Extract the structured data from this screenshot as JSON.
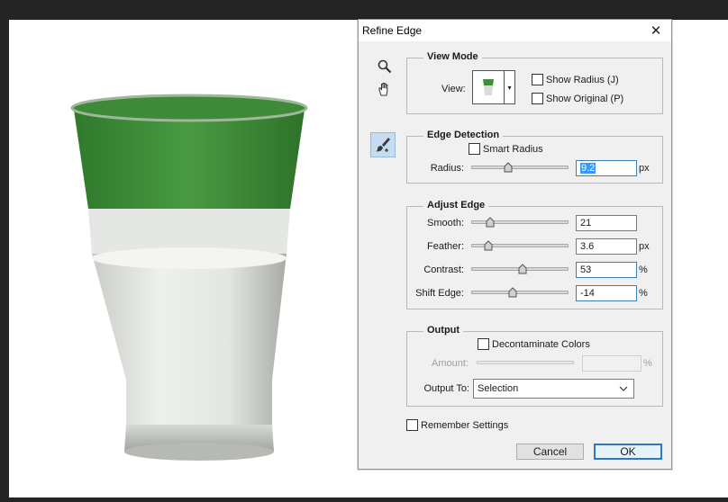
{
  "dialog": {
    "title": "Refine Edge",
    "close_glyph": "✕"
  },
  "tools": {
    "zoom_icon": "magnifier-icon",
    "hand_icon": "hand-icon",
    "refine_radius_icon": "refine-radius-brush-icon"
  },
  "view_mode": {
    "legend": "View Mode",
    "view_label": "View:",
    "dropdown_glyph": "▾",
    "show_radius": "Show Radius (J)",
    "show_original": "Show Original (P)"
  },
  "edge_detection": {
    "legend": "Edge Detection",
    "smart_radius": "Smart Radius",
    "radius_label": "Radius:",
    "radius_value": "9.2",
    "radius_unit": "px",
    "radius_slider_fraction": 0.38
  },
  "adjust_edge": {
    "legend": "Adjust Edge",
    "rows": [
      {
        "label": "Smooth:",
        "value": "21",
        "unit": "",
        "fraction": 0.19
      },
      {
        "label": "Feather:",
        "value": "3.6",
        "unit": "px",
        "fraction": 0.18
      },
      {
        "label": "Contrast:",
        "value": "53",
        "unit": "%",
        "fraction": 0.53
      },
      {
        "label": "Shift Edge:",
        "value": "-14",
        "unit": "%",
        "fraction": 0.43
      }
    ]
  },
  "output": {
    "legend": "Output",
    "decontaminate": "Decontaminate Colors",
    "amount_label": "Amount:",
    "amount_unit": "%",
    "output_to_label": "Output To:",
    "output_to_value": "Selection",
    "chevron_glyph": "⌵"
  },
  "remember_settings": "Remember Settings",
  "buttons": {
    "cancel": "Cancel",
    "ok": "OK"
  },
  "colors": {
    "glass_green": "#3f8f3a",
    "milk": "#e9ebe6",
    "dialog_border": "#6aa0d8",
    "ok_border": "#2f75c9",
    "selection_blue": "#3399ff"
  }
}
